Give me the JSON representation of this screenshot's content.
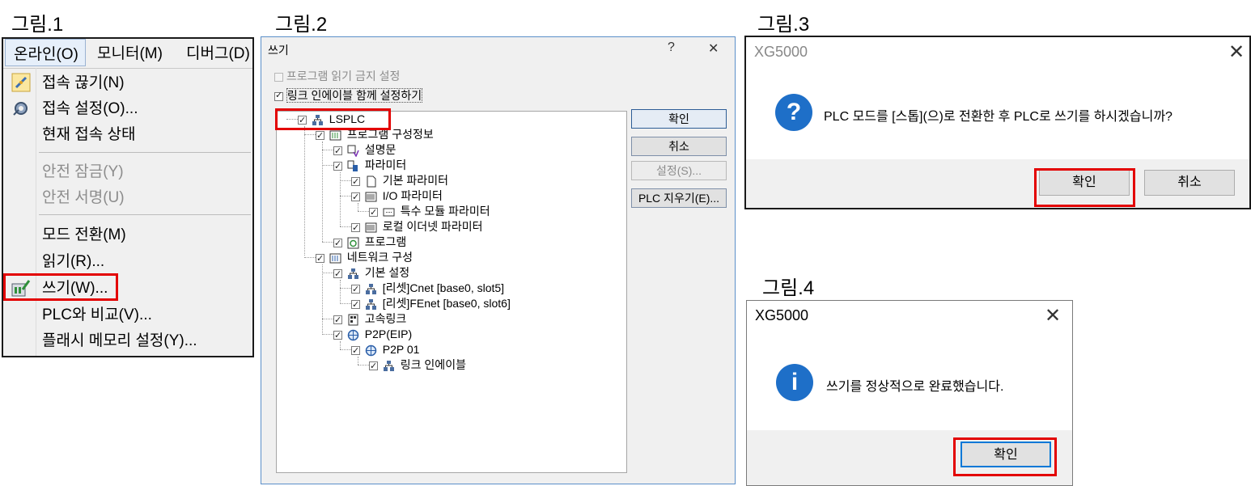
{
  "figures": {
    "fig1": "그림.1",
    "fig2": "그림.2",
    "fig3": "그림.3",
    "fig4": "그림.4"
  },
  "menu": {
    "tabs": [
      "온라인(O)",
      "모니터(M)",
      "디버그(D)"
    ],
    "items": [
      {
        "label": "접속 끊기(N)",
        "icon": "disconnect-icon"
      },
      {
        "label": "접속 설정(O)...",
        "icon": "connection-settings-icon"
      },
      {
        "label": "현재 접속 상태",
        "icon": ""
      },
      {
        "label": "안전 잠금(Y)",
        "icon": "",
        "disabled": true
      },
      {
        "label": "안전 서명(U)",
        "icon": "",
        "disabled": true
      },
      {
        "label": "모드 전환(M)",
        "icon": ""
      },
      {
        "label": "읽기(R)...",
        "icon": ""
      },
      {
        "label": "쓰기(W)...",
        "icon": "write-icon"
      },
      {
        "label": "PLC와 비교(V)...",
        "icon": ""
      },
      {
        "label": "플래시 메모리 설정(Y)...",
        "icon": ""
      }
    ]
  },
  "write_dialog": {
    "title": "쓰기",
    "help": "?",
    "close": "✕",
    "options": [
      {
        "label": "프로그램 읽기 금지 설정",
        "checked": false,
        "disabled": true
      },
      {
        "label": "링크 인에이블 함께 설정하기",
        "checked": true,
        "disabled": false
      }
    ],
    "tree": [
      {
        "label": "LSPLC",
        "level": 0
      },
      {
        "label": "프로그램 구성정보",
        "level": 1
      },
      {
        "label": "설명문",
        "level": 2
      },
      {
        "label": "파라미터",
        "level": 2
      },
      {
        "label": "기본 파라미터",
        "level": 3
      },
      {
        "label": "I/O 파라미터",
        "level": 3
      },
      {
        "label": "특수 모듈 파라미터",
        "level": 4
      },
      {
        "label": "로컬 이더넷 파라미터",
        "level": 3
      },
      {
        "label": "프로그램",
        "level": 2
      },
      {
        "label": "네트워크 구성",
        "level": 1
      },
      {
        "label": "기본 설정",
        "level": 2
      },
      {
        "label": "[리셋]Cnet [base0, slot5]",
        "level": 3
      },
      {
        "label": "[리셋]FEnet [base0, slot6]",
        "level": 3
      },
      {
        "label": "고속링크",
        "level": 2
      },
      {
        "label": "P2P(EIP)",
        "level": 2
      },
      {
        "label": "P2P 01",
        "level": 3
      },
      {
        "label": "링크 인에이블",
        "level": 4
      }
    ],
    "buttons": {
      "ok": "확인",
      "cancel": "취소",
      "settings": "설정(S)...",
      "clear": "PLC 지우기(E)..."
    }
  },
  "confirm_dialog": {
    "title": "XG5000",
    "icon": "question-icon",
    "message": "PLC 모드를 [스톱](으)로 전환한 후 PLC로 쓰기를 하시겠습니까?",
    "ok": "확인",
    "cancel": "취소"
  },
  "done_dialog": {
    "title": "XG5000",
    "icon": "info-icon",
    "message": "쓰기를 정상적으로 완료했습니다.",
    "ok": "확인"
  },
  "colors": {
    "highlight": "#e30000",
    "accent": "#1e6fc8"
  }
}
